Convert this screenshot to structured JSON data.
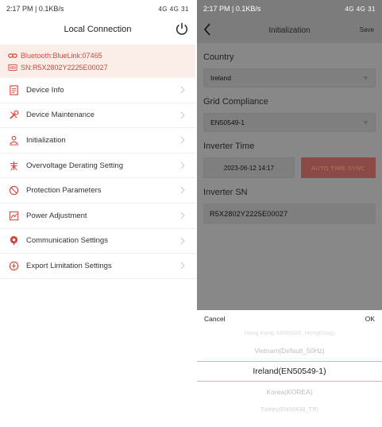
{
  "left": {
    "status": {
      "time": "2:17 PM | 0.1KB/s",
      "signal": "4G 4G 31"
    },
    "title": "Local Connection",
    "connection": {
      "bluetooth": "Bluetooth:BlueLink:07465",
      "serial": "SN:R5X2802Y2225E00027"
    },
    "menu": [
      {
        "label": "Device Info",
        "icon": "document-icon"
      },
      {
        "label": "Device Maintenance",
        "icon": "wrench-icon"
      },
      {
        "label": "Initialization",
        "icon": "person-icon"
      },
      {
        "label": "Overvoltage Derating Setting",
        "icon": "tower-icon"
      },
      {
        "label": "Protection Parameters",
        "icon": "shield-icon"
      },
      {
        "label": "Power Adjustment",
        "icon": "chart-icon"
      },
      {
        "label": "Communication Settings",
        "icon": "antenna-icon"
      },
      {
        "label": "Export Limitation Settings",
        "icon": "export-icon"
      }
    ]
  },
  "right": {
    "status": {
      "time": "2:17 PM | 0.1KB/s",
      "signal": "4G 4G 31"
    },
    "title": "Initialization",
    "save_label": "Save",
    "country": {
      "label": "Country",
      "value": "Ireland"
    },
    "grid": {
      "label": "Grid Compliance",
      "value": "EN50549-1"
    },
    "time": {
      "label": "Inverter Time",
      "value": "2023-06-12 14:17",
      "sync_label": "AUTO TIME SYNC"
    },
    "sn": {
      "label": "Inverter SN",
      "value": "R5X2802Y2225E00027"
    },
    "sheet": {
      "cancel": "Cancel",
      "ok": "OK",
      "options": [
        "Hong Kong SAR(G83_HongKong)",
        "Vietnam(Default_50Hz)",
        "Ireland(EN50549-1)",
        "Korea(KOREA)",
        "Turkey(EN50438_TR)"
      ]
    }
  },
  "colors": {
    "accent": "#d8453a",
    "highlight_bg": "#fbeee8"
  }
}
